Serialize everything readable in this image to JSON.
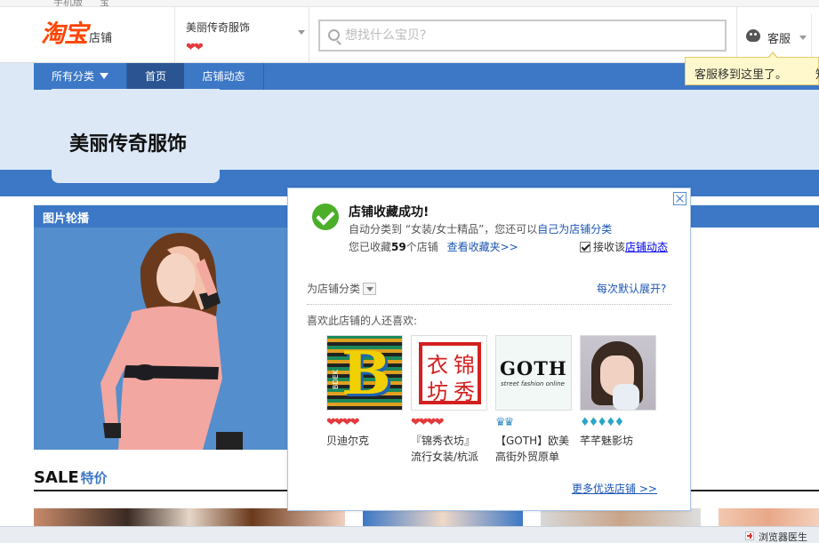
{
  "topstrip": {
    "items": [
      "手机版",
      "宝"
    ]
  },
  "header": {
    "logo_main": "淘宝",
    "logo_sub": "店铺",
    "shop_name": "美丽传奇服饰",
    "shop_rank": "❤❤",
    "search_placeholder": "想找什么宝贝?",
    "kefu_label": "客服"
  },
  "tooltip": {
    "text": "客服移到这里了。",
    "cut": "知"
  },
  "nav": {
    "all_label": "所有分类",
    "home_label": "首页",
    "dynamic_label": "店铺动态"
  },
  "shop_title": "美丽传奇服饰",
  "carousel": {
    "title": "图片轮播"
  },
  "sale": {
    "en": "SALE",
    "cn": "特价"
  },
  "statusbar": {
    "doctor": "浏览器医生"
  },
  "popup": {
    "title": "店铺收藏成功!",
    "line1_prefix": "自动分类到 “女装/女士精品”，您还可以",
    "line1_link": "自己为店铺分类",
    "line2_prefix": "您已收藏",
    "line2_count": "59",
    "line2_suffix": "个店铺",
    "line2_link": "查看收藏夹>>",
    "receive_prefix": "接收该",
    "receive_link": "店铺动态",
    "category_label": "为店铺分类",
    "expand_link": "每次默认展开?",
    "likes_label": "喜欢此店铺的人还喜欢:",
    "more_link": "更多优选店铺 >>",
    "shops": [
      {
        "name": "贝迪尔克",
        "name2": "",
        "rank": "❤❤❤❤",
        "rank_type": "heart",
        "brand": "B",
        "brand_small": "BDEK"
      },
      {
        "name": "『锦秀衣坊』",
        "name2": "流行女装/杭派",
        "rank": "❤❤❤❤",
        "rank_type": "heart",
        "seal": [
          "锦",
          "衣",
          "秀",
          "坊"
        ]
      },
      {
        "name": "【GOTH】欧美",
        "name2": "高街外贸原单",
        "rank": "♛♛",
        "rank_type": "crown",
        "brand": "GOTH",
        "brand_small": "street fashion online"
      },
      {
        "name": "芊芊魅影坊",
        "name2": "",
        "rank": "♦♦♦♦♦",
        "rank_type": "diamond"
      }
    ]
  },
  "colors": {
    "brand": "#ff4400",
    "nav": "#3c78c6",
    "link": "#1a55b4",
    "success": "#4caf2a",
    "heart": "#e4393c"
  }
}
